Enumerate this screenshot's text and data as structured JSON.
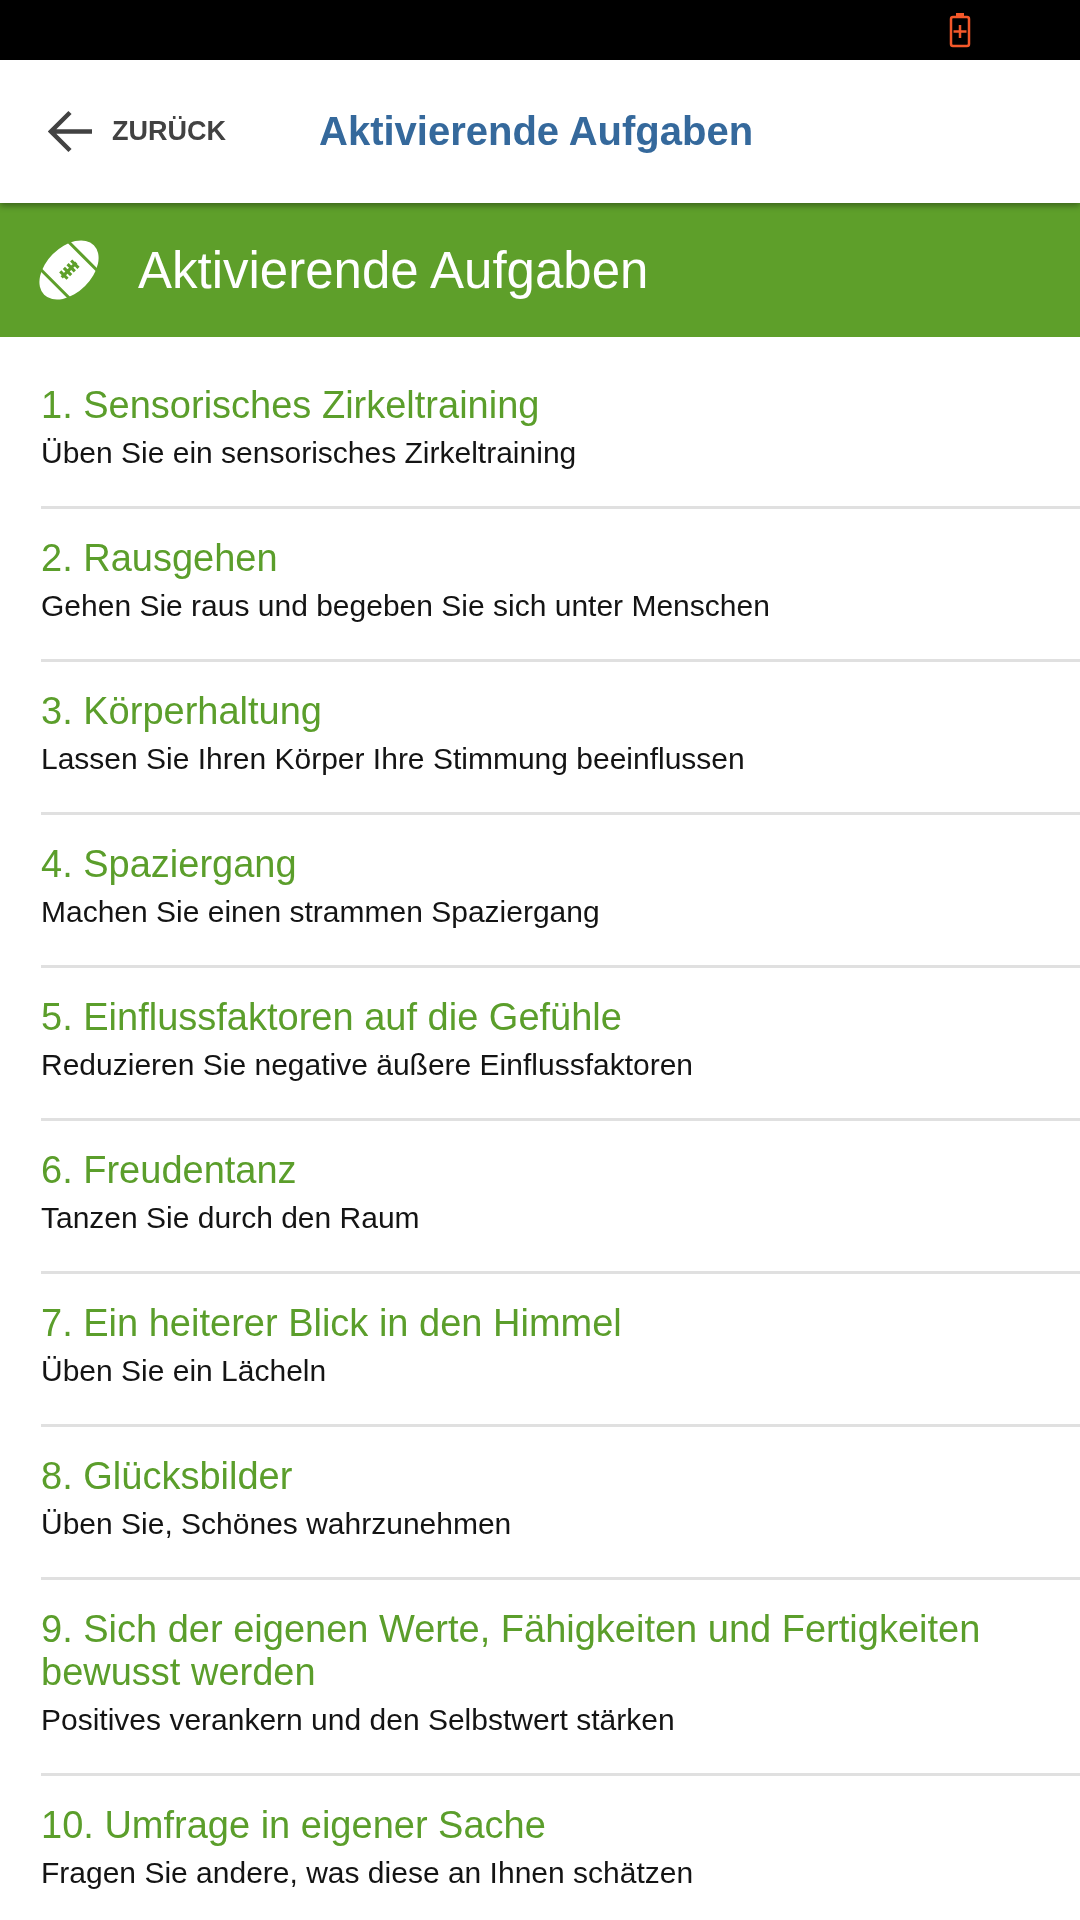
{
  "app_bar": {
    "back_label": "ZURÜCK",
    "title": "Aktivierende Aufgaben"
  },
  "section_header": {
    "title": "Aktivierende Aufgaben"
  },
  "tasks": [
    {
      "title": "1. Sensorisches Zirkeltraining",
      "description": "Üben Sie ein sensorisches Zirkeltraining"
    },
    {
      "title": "2. Rausgehen",
      "description": "Gehen Sie raus und begeben Sie sich unter Menschen"
    },
    {
      "title": "3. Körperhaltung",
      "description": "Lassen Sie Ihren Körper Ihre Stimmung beeinflussen"
    },
    {
      "title": "4. Spaziergang",
      "description": "Machen Sie einen strammen Spaziergang"
    },
    {
      "title": "5. Einflussfaktoren auf die Gefühle",
      "description": "Reduzieren Sie negative äußere Einflussfaktoren"
    },
    {
      "title": "6. Freudentanz",
      "description": "Tanzen Sie durch den Raum"
    },
    {
      "title": "7. Ein heiterer Blick in den Himmel",
      "description": "Üben Sie ein Lächeln"
    },
    {
      "title": "8. Glücksbilder",
      "description": "Üben Sie, Schönes wahrzunehmen"
    },
    {
      "title": "9. Sich der eigenen Werte, Fähigkeiten und Fertigkeiten bewusst werden",
      "description": "Positives verankern und den Selbstwert stärken"
    },
    {
      "title": "10. Umfrage in eigener Sache",
      "description": "Fragen Sie andere, was diese an Ihnen schätzen"
    }
  ]
}
